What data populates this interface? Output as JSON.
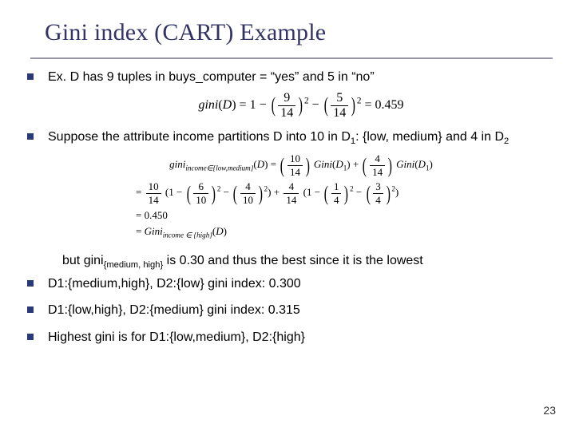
{
  "title": "Gini index (CART) Example",
  "bullets": {
    "b1": "Ex.  D has 9 tuples in buys_computer = “yes” and 5 in “no”",
    "b2_part1": "Suppose the attribute income partitions D into 10 in D",
    "b2_sub1": "1",
    "b2_part2": ": {low, medium} and 4 in D",
    "b2_sub2": "2",
    "note_part1": "but gini",
    "note_sub": "{medium, high}",
    "note_part2": " is 0.30 and thus the best since it is the lowest",
    "b3": "D1:{medium,high}, D2:{low} gini index: 0.300",
    "b4": "D1:{low,high}, D2:{medium} gini index: 0.315",
    "b5": "Highest gini is for D1:{low,medium}, D2:{high}"
  },
  "eq1": {
    "lhs": "gini",
    "arg": "D",
    "one": "1",
    "f1n": "9",
    "f1d": "14",
    "f2n": "5",
    "f2d": "14",
    "sq": "2",
    "result": "0.459"
  },
  "eq2": {
    "lhs": "gini",
    "subscript": "income∈{low,medium}",
    "arg": "D",
    "f1n": "10",
    "f1d": "14",
    "g1": "Gini",
    "g1arg": "D",
    "g1sub": "1",
    "f2n": "4",
    "f2d": "14",
    "g2": "Gini",
    "g2arg": "D",
    "g2sub": "1"
  },
  "eq3": {
    "f1n": "10",
    "f1d": "14",
    "one_a": "1",
    "a1n": "6",
    "a1d": "10",
    "a2n": "4",
    "a2d": "10",
    "sq": "2",
    "f2n": "4",
    "f2d": "14",
    "one_b": "1",
    "b1n": "1",
    "b1d": "4",
    "b2n": "3",
    "b2d": "4"
  },
  "eq4": {
    "result": "0.450"
  },
  "eq5": {
    "lhs": "Gini",
    "subscript": "income ∈ {high}",
    "arg": "D"
  },
  "page": "23"
}
